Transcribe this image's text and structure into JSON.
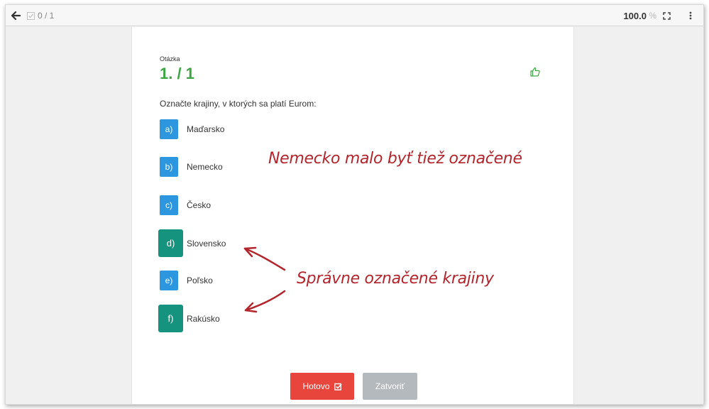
{
  "toolbar": {
    "counter": "0 / 1",
    "zoom_value": "100.0",
    "zoom_unit": "%",
    "icons": [
      "arrow-left-icon",
      "check-icon",
      "fullscreen-icon",
      "more-vert-icon"
    ]
  },
  "question": {
    "label": "Otázka",
    "number": "1. / 1",
    "text": "Označte krajiny, v ktorých sa platí Eurom:"
  },
  "answers": [
    {
      "letter": "a)",
      "text": "Maďarsko",
      "selected": false
    },
    {
      "letter": "b)",
      "text": "Nemecko",
      "selected": false
    },
    {
      "letter": "c)",
      "text": "Česko",
      "selected": false
    },
    {
      "letter": "d)",
      "text": "Slovensko",
      "selected": true
    },
    {
      "letter": "e)",
      "text": "Poľsko",
      "selected": false
    },
    {
      "letter": "f)",
      "text": "Rakúsko",
      "selected": true
    }
  ],
  "buttons": {
    "done": "Hotovo",
    "close": "Zatvoriť"
  },
  "annotations": {
    "missed": "Nemecko malo byť tiež označené",
    "correct": "Správne označené krajiny"
  },
  "colors": {
    "score_green": "#3ea544",
    "answer_blue": "#2c97de",
    "answer_selected_teal": "#16937e",
    "done_red": "#e8463c",
    "close_gray": "#b4b9be",
    "annotation_red": "#b3252d"
  }
}
